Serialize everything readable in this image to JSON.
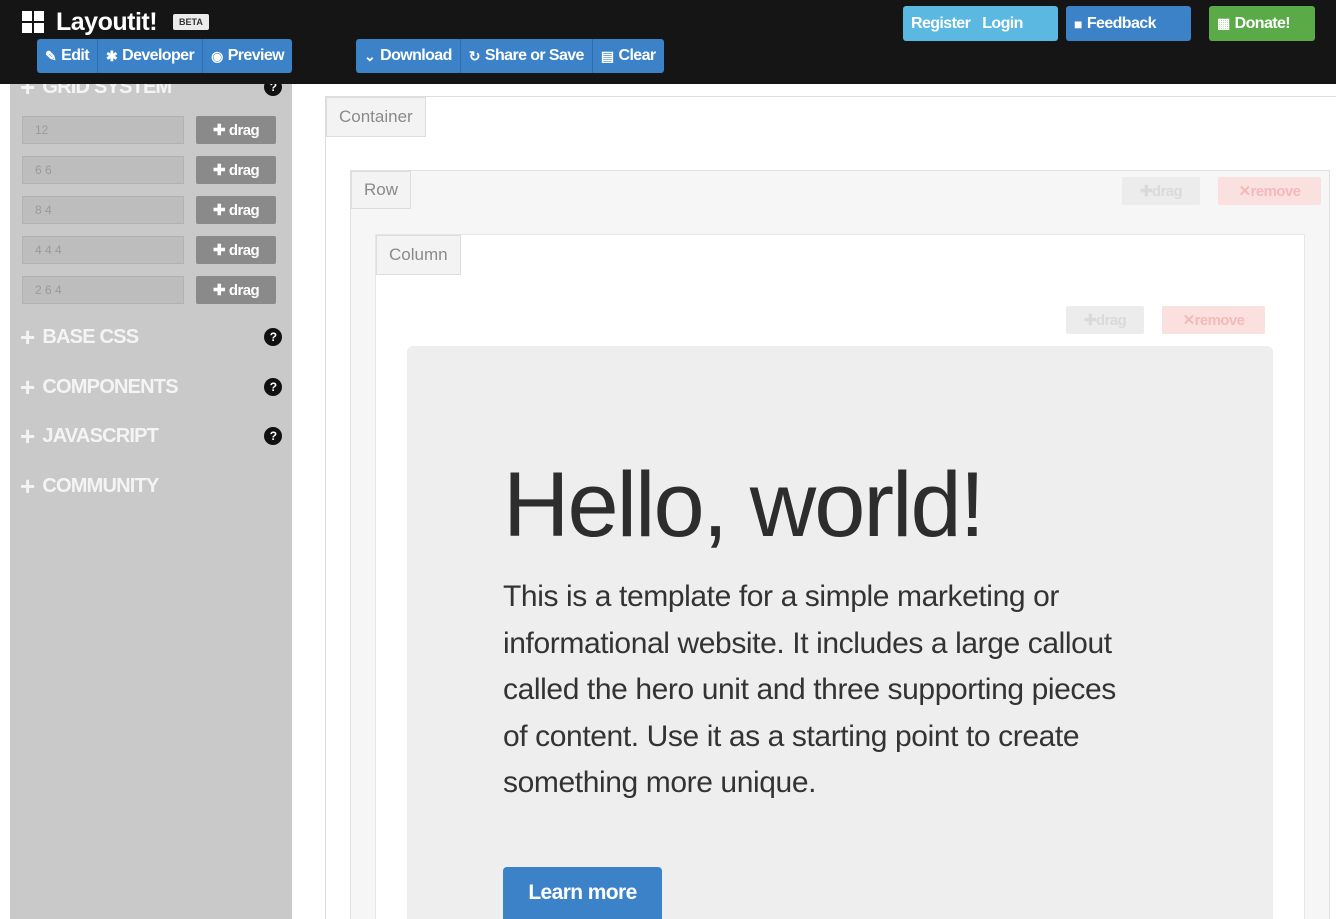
{
  "app": {
    "name": "Layoutit!",
    "badge": "BETA"
  },
  "toolbar": {
    "edit": "Edit",
    "developer": "Developer",
    "preview": "Preview",
    "download": "Download",
    "share": "Share or Save",
    "clear": "Clear"
  },
  "account": {
    "register": "Register",
    "login": "Login"
  },
  "feedback": "Feedback",
  "donate": "Donate!",
  "sidebar": {
    "grid_heading": "GRID SYSTEM",
    "grid_rows": [
      {
        "value": "12",
        "drag": "drag"
      },
      {
        "value": "6 6",
        "drag": "drag"
      },
      {
        "value": "8 4",
        "drag": "drag"
      },
      {
        "value": "4 4 4",
        "drag": "drag"
      },
      {
        "value": "2 6 4",
        "drag": "drag"
      }
    ],
    "sections": [
      "BASE CSS",
      "COMPONENTS",
      "JAVASCRIPT",
      "COMMUNITY"
    ]
  },
  "canvas": {
    "container_label": "Container",
    "row_label": "Row",
    "column_label": "Column",
    "drag_label": "drag",
    "remove_label": "remove"
  },
  "hero": {
    "title": "Hello, world!",
    "text": "This is a template for a simple marketing or informational website. It includes a large callout called the hero unit and three supporting pieces of content. Use it as a starting point to create something more unique.",
    "button": "Learn more"
  },
  "colors": {
    "topbar": "#151515",
    "primary": "#3b82c8",
    "info": "#5bb8e0",
    "success": "#5aab47",
    "sidebar": "#c9c9c9",
    "hero": "#eeeeee"
  },
  "icons": [
    "grid-logo-icon",
    "edit-icon",
    "developer-icon",
    "eye-icon",
    "chevron-down-icon",
    "refresh-icon",
    "trash-icon",
    "comment-icon",
    "gift-icon",
    "move-icon",
    "remove-icon",
    "plus-icon",
    "help-icon"
  ]
}
